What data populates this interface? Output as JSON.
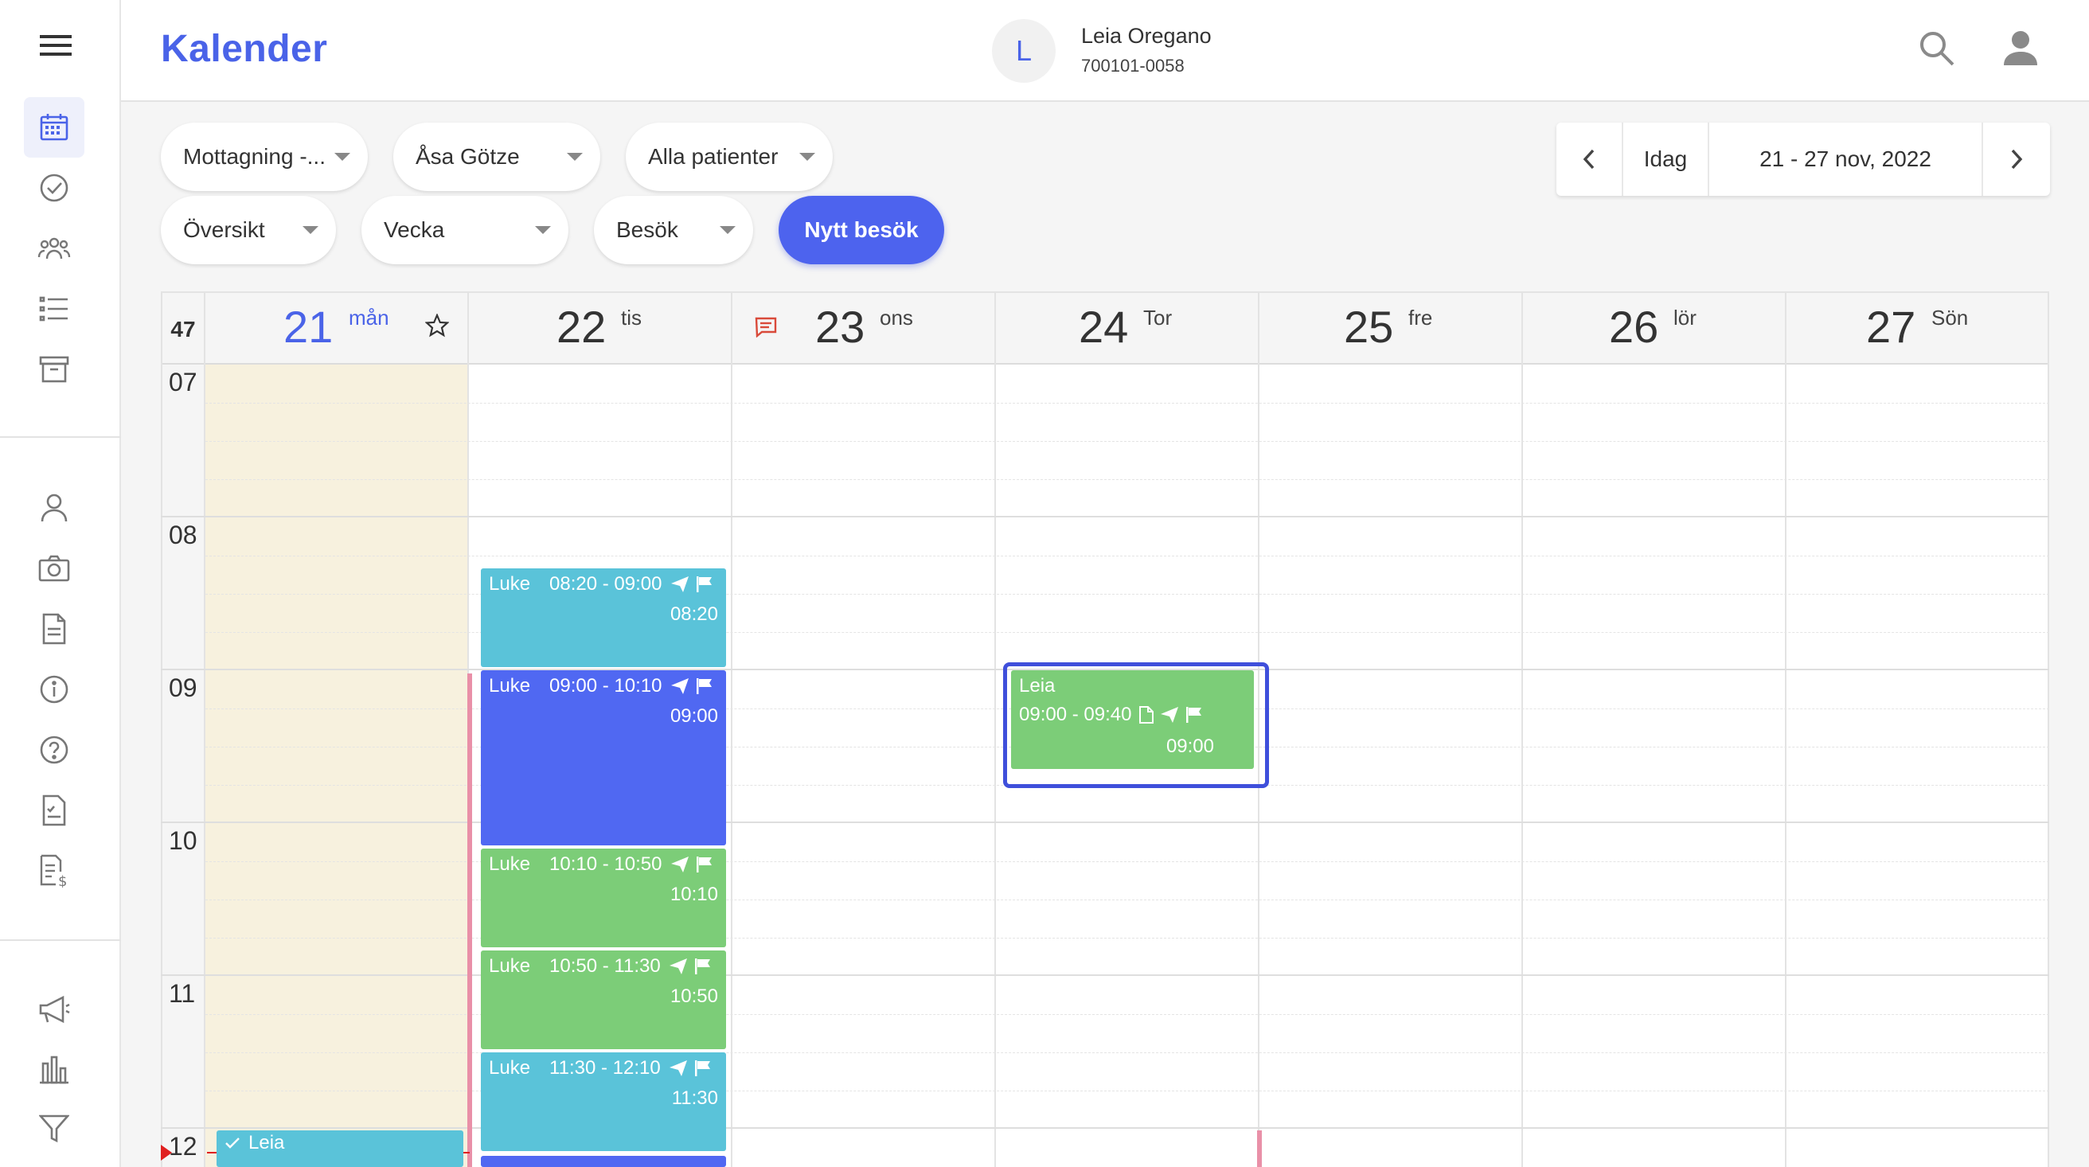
{
  "app": {
    "title": "Kalender"
  },
  "patient": {
    "initial": "L",
    "name": "Leia Oregano",
    "id": "700101-0058"
  },
  "filters": {
    "reception": "Mottagning -...",
    "practitioner": "Åsa Götze",
    "patients": "Alla patienter",
    "view": "Översikt",
    "period": "Vecka",
    "type": "Besök",
    "new_visit": "Nytt besök"
  },
  "datenav": {
    "today": "Idag",
    "range": "21 - 27 nov, 2022"
  },
  "calendar": {
    "week": "47",
    "days": [
      {
        "num": "21",
        "name": "mån"
      },
      {
        "num": "22",
        "name": "tis"
      },
      {
        "num": "23",
        "name": "ons"
      },
      {
        "num": "24",
        "name": "Tor"
      },
      {
        "num": "25",
        "name": "fre"
      },
      {
        "num": "26",
        "name": "lör"
      },
      {
        "num": "27",
        "name": "Sön"
      }
    ],
    "hours": [
      "07",
      "08",
      "09",
      "10",
      "11",
      "12"
    ],
    "events": [
      {
        "name": "Luke",
        "time": "08:20 - 09:00",
        "start": "08:20"
      },
      {
        "name": "Luke",
        "time": "09:00 - 10:10",
        "start": "09:00"
      },
      {
        "name": "Luke",
        "time": "10:10 - 10:50",
        "start": "10:10"
      },
      {
        "name": "Luke",
        "time": "10:50 - 11:30",
        "start": "10:50"
      },
      {
        "name": "Luke",
        "time": "11:30 - 12:10",
        "start": "11:30"
      },
      {
        "name": "Leia",
        "time": "09:00 - 09:40",
        "start": "09:00"
      },
      {
        "name": "Leia"
      }
    ]
  },
  "colors": {
    "accent": "#4a63e8",
    "cyan": "#5ac3d9",
    "blue": "#5068f2",
    "green": "#7ccd78",
    "today_bg": "#f7f1de",
    "marker": "#e990a8"
  }
}
